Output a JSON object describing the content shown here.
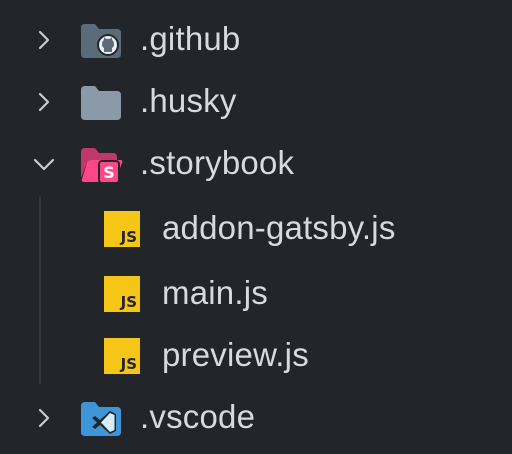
{
  "explorer": {
    "items": [
      {
        "label": ".github",
        "icon": "folder-github-icon",
        "expanded": false,
        "icon_color": "#5b6b7a"
      },
      {
        "label": ".husky",
        "icon": "folder-icon",
        "expanded": false,
        "icon_color": "#8a9aa8"
      },
      {
        "label": ".storybook",
        "icon": "folder-storybook-open-icon",
        "expanded": true,
        "icon_color": "#ff4785"
      },
      {
        "label": ".vscode",
        "icon": "folder-vscode-icon",
        "expanded": false,
        "icon_color": "#3e95d8"
      }
    ],
    "storybook_children": [
      {
        "label": "addon-gatsby.js",
        "icon": "javascript-file-icon",
        "badge": "JS"
      },
      {
        "label": "main.js",
        "icon": "javascript-file-icon",
        "badge": "JS"
      },
      {
        "label": "preview.js",
        "icon": "javascript-file-icon",
        "badge": "JS"
      }
    ]
  },
  "colors": {
    "background": "#22262b",
    "text": "#d6dae0",
    "chevron": "#c8ccd2",
    "js_badge": "#f5c518"
  }
}
